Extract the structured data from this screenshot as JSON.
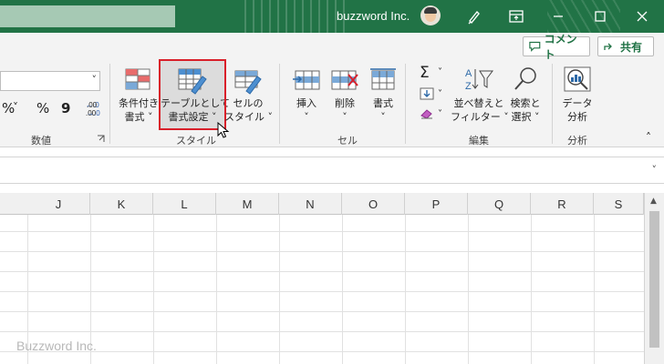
{
  "titlebar": {
    "account_name": "buzzword Inc.",
    "icons": [
      "pen-icon",
      "ribbon-display-icon",
      "minimize-icon",
      "restore-icon",
      "close-icon"
    ]
  },
  "toolbar": {
    "comment_label": "コメント",
    "share_label": "共有"
  },
  "ribbon": {
    "number_group": {
      "label": "数値",
      "symbols": [
        "%",
        "9",
        "←.0 .00",
        ".00 →.0"
      ]
    },
    "style_group": {
      "label": "スタイル",
      "conditional_format": {
        "line1": "条件付き",
        "line2": "書式 ˅"
      },
      "format_as_table": {
        "line1": "テーブルとして",
        "line2": "書式設定 ˅"
      },
      "cell_styles": {
        "line1": "セルの",
        "line2": "スタイル ˅"
      }
    },
    "cells_group": {
      "label": "セル",
      "insert": {
        "line1": "挿入",
        "line2": "˅"
      },
      "delete": {
        "line1": "削除",
        "line2": "˅"
      },
      "format": {
        "line1": "書式",
        "line2": "˅"
      }
    },
    "edit_group": {
      "label": "編集",
      "sort_filter": {
        "line1": "並べ替えと",
        "line2": "フィルター ˅"
      },
      "find_select": {
        "line1": "検索と",
        "line2": "選択 ˅"
      }
    },
    "analysis_group": {
      "label": "分析",
      "data_analysis": {
        "line1": "データ",
        "line2": "分析"
      }
    }
  },
  "columns": [
    "J",
    "K",
    "L",
    "M",
    "N",
    "O",
    "P",
    "Q",
    "R",
    "S"
  ],
  "watermark": "Buzzword Inc.",
  "colors": {
    "excel_green": "#217346",
    "highlight_red": "#d9202a"
  }
}
